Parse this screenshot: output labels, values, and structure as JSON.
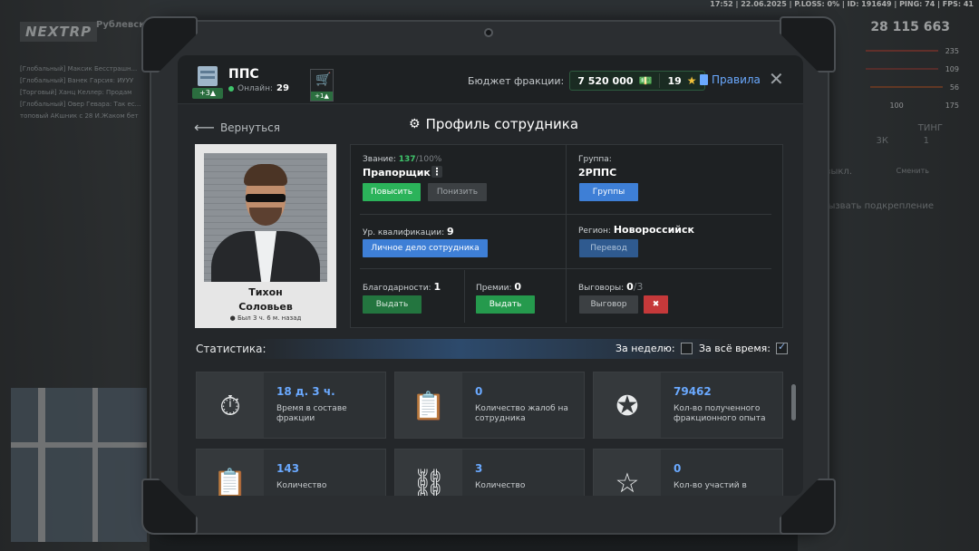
{
  "hud": {
    "topline": "17:52 | 22.06.2025 | P.LOSS: 0% | ID: 191649 | PING: 74 | FPS: 41",
    "money": "28 115 663",
    "stats": [
      "235",
      "109",
      "56",
      "100",
      "175"
    ],
    "side_items": [
      "ТИНГ",
      "3К",
      "1",
      "выкл.",
      "Сменить",
      "вызвать подкрепление"
    ]
  },
  "background": {
    "logo": "NEXTRP",
    "server": "Рублевский",
    "chat": [
      "[Глобальный] Максик Бесстрашн...",
      "[Глобальный] Ванек Гарсия: ИУУУ",
      "[Торговый] Ханц Келлер: Продам",
      "[Глобальный] Овер Гевара: Так ес...",
      "топовый АКшник с 28 И.Жаком бет"
    ]
  },
  "topbar": {
    "faction_name": "ППС",
    "faction_badge": "+3",
    "online_label": "Онлайн:",
    "online_count": "29",
    "cart_badge": "+1",
    "budget_label": "Бюджет фракции:",
    "budget_value": "7 520 000",
    "coins_value": "19",
    "rules_label": "Правила"
  },
  "header": {
    "back_label": "Вернуться",
    "title": "Профиль сотрудника"
  },
  "employee": {
    "first_name": "Тихон",
    "last_name": "Соловьев",
    "last_seen": "Был 3 ч. 6 м. назад"
  },
  "info": {
    "rank_label": "Звание:",
    "rank_points": "137",
    "rank_points_max": "/100%",
    "rank_name": "Прапорщик",
    "promote_label": "Повысить",
    "demote_label": "Понизить",
    "group_label": "Группа:",
    "group_value": "2РППС",
    "groups_button": "Группы",
    "qual_label": "Ур. квалификации:",
    "qual_value": "9",
    "personal_file_button": "Личное дело сотрудника",
    "region_label": "Регион:",
    "region_value": "Новороссийск",
    "transfer_button": "Перевод",
    "thanks_label": "Благодарности:",
    "thanks_value": "1",
    "thanks_button": "Выдать",
    "bonus_label": "Премии:",
    "bonus_value": "0",
    "bonus_button": "Выдать",
    "reprimand_label": "Выговоры:",
    "reprimand_value": "0",
    "reprimand_max": "/3",
    "reprimand_button": "Выговор"
  },
  "stats": {
    "title": "Статистика:",
    "week_label": "За неделю:",
    "all_time_label": "За всё время:",
    "cards": [
      {
        "value": "18 д. 3 ч.",
        "desc": "Время в составе фракции"
      },
      {
        "value": "0",
        "desc": "Количество жалоб на сотрудника"
      },
      {
        "value": "79462",
        "desc": "Кол-во полученного фракционного опыта"
      },
      {
        "value": "143",
        "desc": "Количество"
      },
      {
        "value": "3",
        "desc": "Количество"
      },
      {
        "value": "0",
        "desc": "Кол-во участий в"
      }
    ]
  },
  "colors": {
    "accent_blue": "#6aa9ff",
    "green": "#2bb35a",
    "red": "#c5393a"
  }
}
